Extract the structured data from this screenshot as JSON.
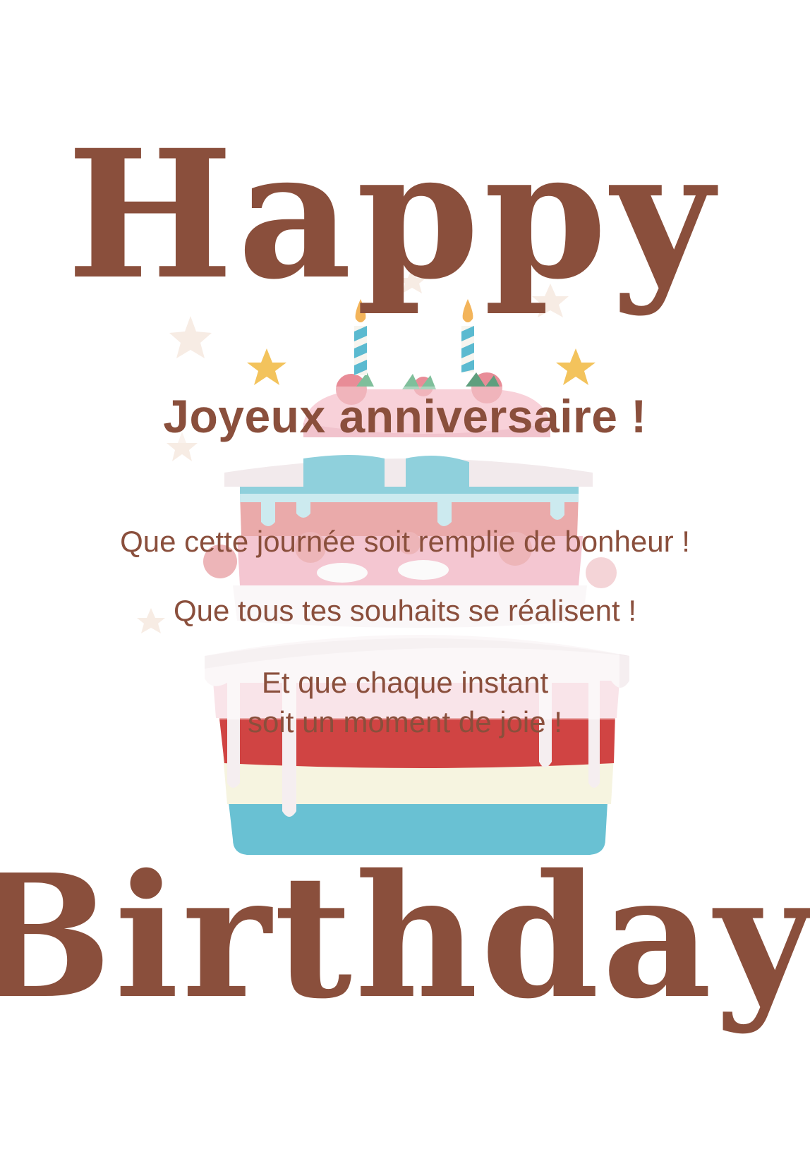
{
  "card": {
    "top_word": "Happy",
    "bottom_word": "Birthday",
    "heading": "Joyeux anniversaire !",
    "message_lines": [
      "Que cette journée soit remplie de bonheur !",
      "Que tous tes souhaits se réalisent !",
      "Et que chaque instant",
      "soit un moment de joie !"
    ]
  },
  "colors": {
    "text_brown": "#8a4f3c",
    "cake_red": "#d04443",
    "cake_cream": "#f6f4e0",
    "cake_blue": "#69c1d3",
    "cake_pink": "#eb8ca4",
    "candle_flame": "#f3b45a",
    "star_gold": "#f3c35c"
  },
  "icons": [
    "birthday-cake-icon",
    "candle-icon",
    "star-icon",
    "strawberry-icon",
    "leaf-icon"
  ]
}
